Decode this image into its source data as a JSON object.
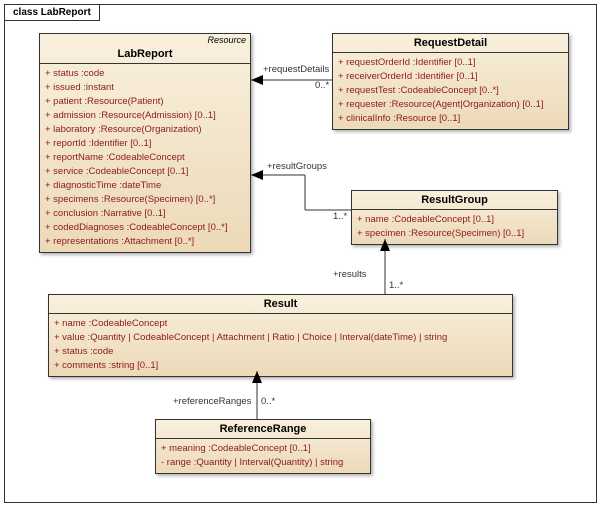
{
  "frame_title": "class LabReport",
  "classes": {
    "labreport": {
      "stereotype": "Resource",
      "name": "LabReport",
      "attrs": [
        "+  status :code",
        "+  issued :instant",
        "+  patient :Resource(Patient)",
        "+  admission :Resource(Admission) [0..1]",
        "+  laboratory :Resource(Organization)",
        "+  reportId :Identifier [0..1]",
        "+  reportName :CodeableConcept",
        "+  service :CodeableConcept [0..1]",
        "+  diagnosticTime :dateTime",
        "+  specimens :Resource(Specimen) [0..*]",
        "+  conclusion :Narrative [0..1]",
        "+  codedDiagnoses :CodeableConcept [0..*]",
        "+  representations :Attachment [0..*]"
      ]
    },
    "requestdetail": {
      "name": "RequestDetail",
      "attrs": [
        "+  requestOrderId :Identifier [0..1]",
        "+  receiverOrderId :Identifier [0..1]",
        "+  requestTest :CodeableConcept [0..*]",
        "+  requester :Resource(Agent|Organization) [0..1]",
        "+  clinicalInfo :Resource [0..1]"
      ]
    },
    "resultgroup": {
      "name": "ResultGroup",
      "attrs": [
        "+  name :CodeableConcept [0..1]",
        "+  specimen :Resource(Specimen) [0..1]"
      ]
    },
    "result": {
      "name": "Result",
      "attrs": [
        "+  name :CodeableConcept",
        "+  value :Quantity | CodeableConcept | Attachment | Ratio | Choice | Interval(dateTime) | string",
        "+  status :code",
        "+  comments :string [0..1]"
      ]
    },
    "referencerange": {
      "name": "ReferenceRange",
      "attrs": [
        "+  meaning :CodeableConcept [0..1]",
        "-  range :Quantity | Interval(Quantity) | string"
      ]
    }
  },
  "assocs": {
    "requestDetails": {
      "label": "+requestDetails",
      "mult": "0..*"
    },
    "resultGroups": {
      "label": "+resultGroups",
      "mult": "1..*"
    },
    "results": {
      "label": "+results",
      "mult": "1..*"
    },
    "referenceRanges": {
      "label": "+referenceRanges",
      "mult": "0..*"
    }
  }
}
